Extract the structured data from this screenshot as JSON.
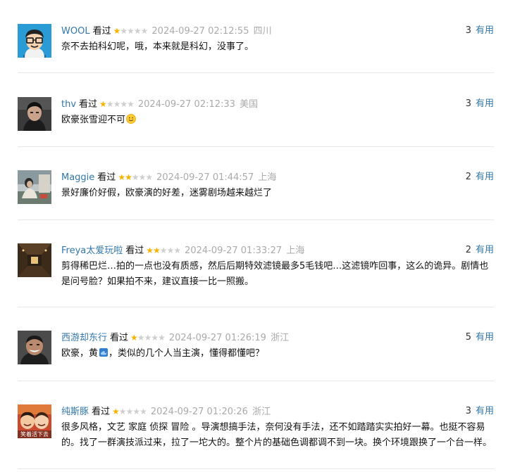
{
  "comments": [
    {
      "user": "WOOL",
      "watched": "看过",
      "stars": 1,
      "time": "2024-09-27 02:12:55",
      "location": "四川",
      "votes": "3",
      "vote_label": "有用",
      "text": "奈不去拍科幻呢，哦，本来就是科幻，没事了。",
      "avatar_icon": "cartoon-glasses-avatar"
    },
    {
      "user": "thv",
      "watched": "看过",
      "stars": 1,
      "time": "2024-09-27 02:12:33",
      "location": "美国",
      "votes": "3",
      "vote_label": "有用",
      "text": "欧豪张雪迎不可",
      "emoji": "smile-emoji",
      "avatar_icon": "dark-portrait-avatar"
    },
    {
      "user": "Maggie",
      "watched": "看过",
      "stars": 2,
      "time": "2024-09-27 01:44:57",
      "location": "上海",
      "votes": "2",
      "vote_label": "有用",
      "text": "景好廉价好假，欧豪演的好差，迷雾剧场越来越烂了",
      "avatar_icon": "outdoor-photo-avatar"
    },
    {
      "user": "Freya太爱玩啦",
      "watched": "看过",
      "stars": 2,
      "time": "2024-09-27 01:33:27",
      "location": "上海",
      "votes": "2",
      "vote_label": "有用",
      "text": "剪得稀巴烂…拍的一点也没有质感，然后后期特效滤镜最多5毛钱吧…这滤镜咋回事，这么的诡异。剧情也是问号脸？如果拍不来，建议直接一比一照搬。",
      "avatar_icon": "corridor-photo-avatar"
    },
    {
      "user": "西游却东行",
      "watched": "看过",
      "stars": 1,
      "time": "2024-09-27 01:26:19",
      "location": "浙江",
      "votes": "5",
      "vote_label": "有用",
      "text": "欧豪，黄",
      "text_after": "，类似的几个人当主演，懂得都懂吧？",
      "emoji": "tuna-emoji",
      "avatar_icon": "smiling-man-avatar"
    },
    {
      "user": "纯斯豚",
      "watched": "看过",
      "stars": 1,
      "time": "2024-09-27 01:20:26",
      "location": "浙江",
      "votes": "3",
      "vote_label": "有用",
      "text": "很多风格，文艺 家庭 侦探 冒险 。导演想搞手法，奈何没有手法，还不如踏踏实实拍好一幕。也挺不容易的。找了一群演技派过来，拉了一坨大的。整个片的基础色调都调不到一块。换个环境跟换了一个台一样。",
      "avatar_icon": "meme-kids-avatar",
      "avatar_caption": "笑着活下去"
    }
  ],
  "colors": {
    "link": "#3377aa",
    "star_on": "#f5b400",
    "star_off": "#cfcfcf",
    "meta_gray": "#aaaaaa"
  }
}
